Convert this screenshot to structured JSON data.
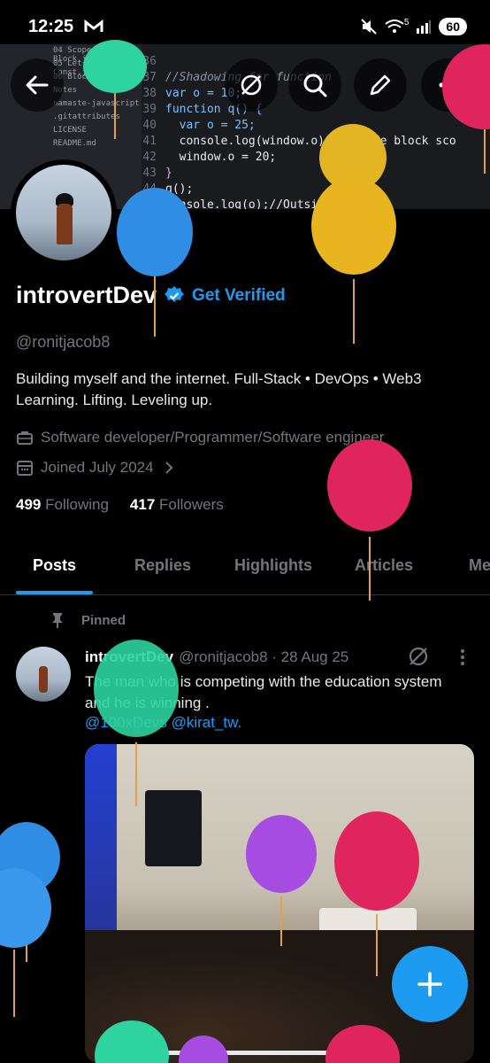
{
  "status_bar": {
    "time": "12:25",
    "network": "5",
    "battery": "60"
  },
  "banner": {
    "sidebar_files": [
      "04 Scope and Block.js",
      "05 Let and Const.js",
      "06 Block Scope.js",
      "Notes",
      "namaste-javascript",
      ".gitattributes",
      "LICENSE",
      "README.md"
    ],
    "code": [
      {
        "num": "36",
        "src": ""
      },
      {
        "num": "37",
        "src": "//Shadowing for function"
      },
      {
        "num": "38",
        "src": "var o = 10;"
      },
      {
        "num": "39",
        "src": "function q() {"
      },
      {
        "num": "40",
        "src": "  var o = 25;"
      },
      {
        "num": "41",
        "src": "  console.log(window.o);//Inside block sco"
      },
      {
        "num": "42",
        "src": "  window.o = 20;"
      },
      {
        "num": "43",
        "src": "}"
      },
      {
        "num": "44",
        "src": "q();"
      },
      {
        "num": "45",
        "src": "console.log(o);//Outside"
      }
    ]
  },
  "profile": {
    "name": "introvertDev",
    "get_verified": "Get Verified",
    "handle": "@ronitjacob8",
    "bio": "Building myself and the internet. Full-Stack • DevOps • Web3 Learning. Lifting. Leveling up.",
    "job": "Software developer/Programmer/Software engineer",
    "joined": "Joined July 2024",
    "following_count": "499",
    "following_label": "Following",
    "followers_count": "417",
    "followers_label": "Followers"
  },
  "tabs": [
    "Posts",
    "Replies",
    "Highlights",
    "Articles",
    "Me"
  ],
  "post": {
    "pinned_label": "Pinned",
    "author": "introvertDev",
    "handle_date": "@ronitjacob8 · 28 Aug 25",
    "text": "The man who is competing with the education system and he is winning .",
    "mentions": "@100xDevs @kirat_tw."
  },
  "colors": {
    "accent": "#1d9bf0",
    "background": "#000000",
    "muted": "#71767b"
  }
}
